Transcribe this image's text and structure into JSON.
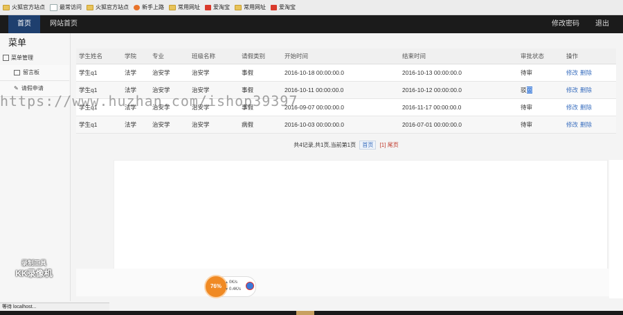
{
  "bookmarks": [
    {
      "label": "火狐官方站点",
      "icon": "folder-icon"
    },
    {
      "label": "最常访问",
      "icon": "page-icon"
    },
    {
      "label": "火狐官方站点",
      "icon": "folder-icon"
    },
    {
      "label": "新手上路",
      "icon": "firefox-icon"
    },
    {
      "label": "常用网址",
      "icon": "folder-icon"
    },
    {
      "label": "爱淘宝",
      "icon": "taobao-icon"
    },
    {
      "label": "常用网址",
      "icon": "folder-icon"
    },
    {
      "label": "爱淘宝",
      "icon": "taobao-icon"
    }
  ],
  "nav": {
    "home": "首页",
    "site_home": "网站首页",
    "change_password": "修改密码",
    "logout": "退出"
  },
  "sidebar": {
    "title": "菜单",
    "group": "菜单管理",
    "items": [
      {
        "label": "留言板"
      },
      {
        "label": "请假申请"
      }
    ]
  },
  "table": {
    "headers": [
      "学生姓名",
      "学院",
      "专业",
      "班级名称",
      "请假类别",
      "开始时间",
      "结束时间",
      "审批状态",
      "操作"
    ],
    "rows": [
      {
        "name": "学生q1",
        "college": "法学",
        "major": "治安学",
        "class": "治安学",
        "type": "事假",
        "start": "2016-10-18 00:00:00.0",
        "end": "2016-10-13 00:00:00.0",
        "status_a": "待审",
        "status_b": "",
        "edit": "修改",
        "delete": "删除"
      },
      {
        "name": "学生q1",
        "college": "法学",
        "major": "治安学",
        "class": "治安学",
        "type": "事假",
        "start": "2016-10-11 00:00:00.0",
        "end": "2016-10-12 00:00:00.0",
        "status_a": "驳",
        "status_b": "回",
        "edit": "修改",
        "delete": "删除"
      },
      {
        "name": "学生q1",
        "college": "法学",
        "major": "治安学",
        "class": "治安学",
        "type": "事假",
        "start": "2016-09-07 00:00:00.0",
        "end": "2016-11-17 00:00:00.0",
        "status_a": "待审",
        "status_b": "",
        "edit": "修改",
        "delete": "删除"
      },
      {
        "name": "学生q1",
        "college": "法学",
        "major": "治安学",
        "class": "治安学",
        "type": "病假",
        "start": "2016-10-03 00:00:00.0",
        "end": "2016-07-01 00:00:00.0",
        "status_a": "待审",
        "status_b": "",
        "edit": "修改",
        "delete": "删除"
      }
    ]
  },
  "pager": {
    "summary": "共4记录,共1页,当前第1页",
    "first": "首页",
    "current": "[1]",
    "last": "尾页"
  },
  "watermark": {
    "url": "https://www.huzhan.com/ishop39397",
    "logo_line1": "录制工具",
    "logo_line2": "KK录像机"
  },
  "speed_widget": {
    "percent": "76%",
    "up": "0K/s",
    "down": "0.4K/s"
  },
  "status_bar": "等待 localhost..."
}
